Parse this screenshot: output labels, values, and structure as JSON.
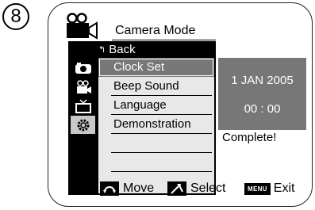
{
  "step_number": "8",
  "menu": {
    "title": "Camera Mode",
    "back_label": "Back",
    "items": [
      {
        "label": "Clock Set",
        "selected": true
      },
      {
        "label": "Beep Sound"
      },
      {
        "label": "Language"
      },
      {
        "label": "Demonstration"
      },
      {
        "label": ""
      },
      {
        "label": ""
      }
    ],
    "side_icons": [
      "record-icon",
      "camera-icon",
      "tv-icon",
      "settings-gear-icon"
    ]
  },
  "popup": {
    "date": "1  JAN  2005",
    "time": "00 : 00"
  },
  "status": "Complete!",
  "hints": {
    "move": "Move",
    "select": "Select",
    "menu_key": "MENU",
    "exit": "Exit"
  },
  "colors": {
    "highlight": "#777777",
    "menu_bg": "#000000",
    "list_bg": "#e8e8e8"
  }
}
